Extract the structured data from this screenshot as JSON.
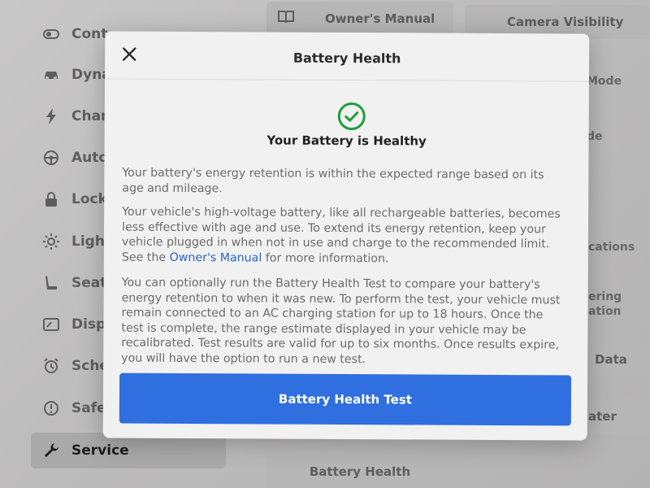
{
  "sidebar": {
    "items": [
      {
        "label": "Cont",
        "icon": "toggle-icon"
      },
      {
        "label": "Dyna",
        "icon": "car-icon"
      },
      {
        "label": "Char",
        "icon": "lightning-icon"
      },
      {
        "label": "Auto",
        "icon": "steering-wheel-icon"
      },
      {
        "label": "Lock",
        "icon": "lock-icon"
      },
      {
        "label": "Ligh",
        "icon": "sun-icon"
      },
      {
        "label": "Seat",
        "icon": "seat-icon"
      },
      {
        "label": "Disp",
        "icon": "display-icon"
      },
      {
        "label": "Sche",
        "icon": "alarm-icon"
      },
      {
        "label": "Safe",
        "icon": "alert-icon"
      },
      {
        "label": "Service",
        "icon": "wrench-icon"
      }
    ]
  },
  "background": {
    "owners_manual": "Owner's Manual",
    "camera_visibility": "Camera Visibility",
    "mode_fragment": "Mode",
    "de_fragment": "de",
    "cations_fragment": "cations",
    "ering_fragment": "ering",
    "ation_fragment": "ation",
    "data_fragment": "Data",
    "ater_fragment": "ater",
    "battery_health_button": "Battery Health"
  },
  "modal": {
    "title": "Battery Health",
    "status": "Your Battery is Healthy",
    "paragraph1": "Your battery's energy retention is within the expected range based on its age and mileage.",
    "paragraph2_before": "Your vehicle's high-voltage battery, like all rechargeable batteries, becomes less effective with age and use. To extend its energy retention, keep your vehicle plugged in when not in use and charge to the recommended limit. See the ",
    "paragraph2_link": "Owner's Manual",
    "paragraph2_after": " for more information.",
    "paragraph3": "You can optionally run the Battery Health Test to compare your battery's energy retention to when it was new. To perform the test, your vehicle must remain connected to an AC charging station for up to 18 hours. Once the test is complete, the range estimate displayed in your vehicle may be recalibrated. Test results are valid for up to six months. Once results expire, you will have the option to run a new test.",
    "button_label": "Battery Health Test",
    "accent_color": "#2f6fe0",
    "success_color": "#1f9d3a"
  }
}
